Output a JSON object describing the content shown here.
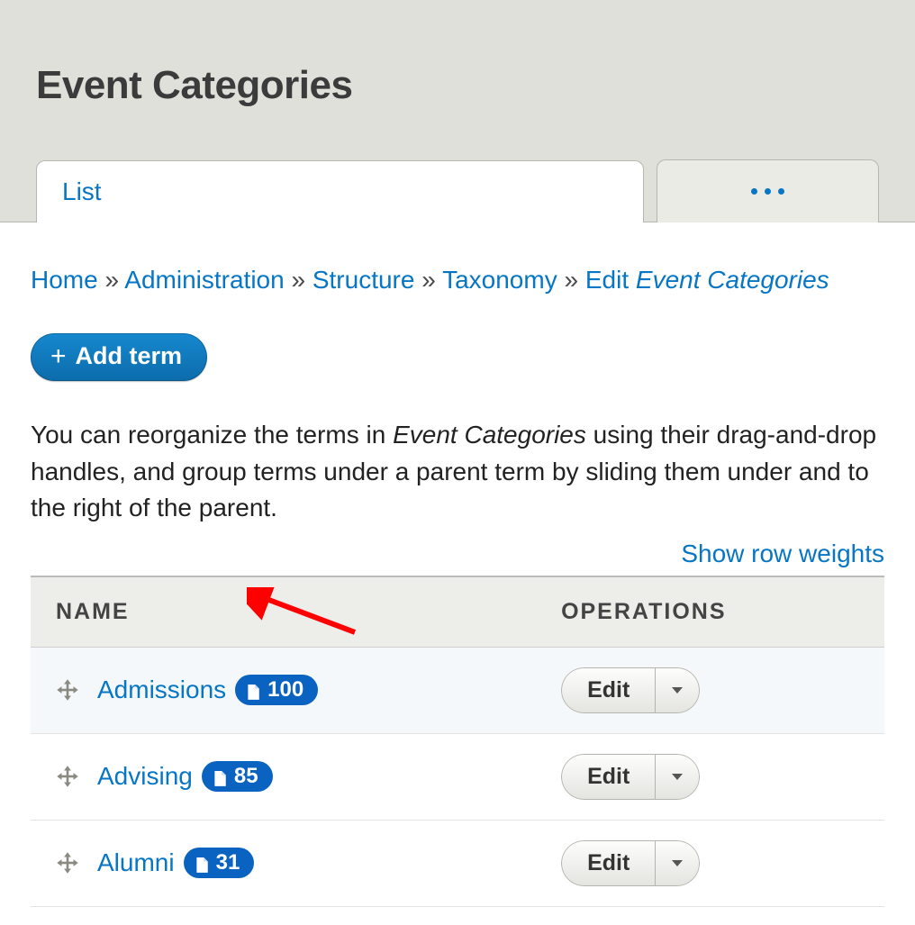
{
  "page": {
    "title": "Event Categories"
  },
  "tabs": {
    "active_label": "List"
  },
  "breadcrumb": {
    "items": [
      "Home",
      "Administration",
      "Structure",
      "Taxonomy"
    ],
    "tail_prefix": "Edit",
    "tail_em": "Event Categories",
    "sep": "»"
  },
  "actions": {
    "add_term_label": "Add term"
  },
  "help": {
    "pre": "You can reorganize the terms in ",
    "em": "Event Categories",
    "post": " using their drag-and-drop handles, and group terms under a parent term by sliding them under and to the right of the parent."
  },
  "table": {
    "show_weights": "Show row weights",
    "col_name": "NAME",
    "col_ops": "OPERATIONS",
    "edit_label": "Edit",
    "rows": [
      {
        "name": "Admissions",
        "count": "100"
      },
      {
        "name": "Advising",
        "count": "85"
      },
      {
        "name": "Alumni",
        "count": "31"
      }
    ]
  }
}
